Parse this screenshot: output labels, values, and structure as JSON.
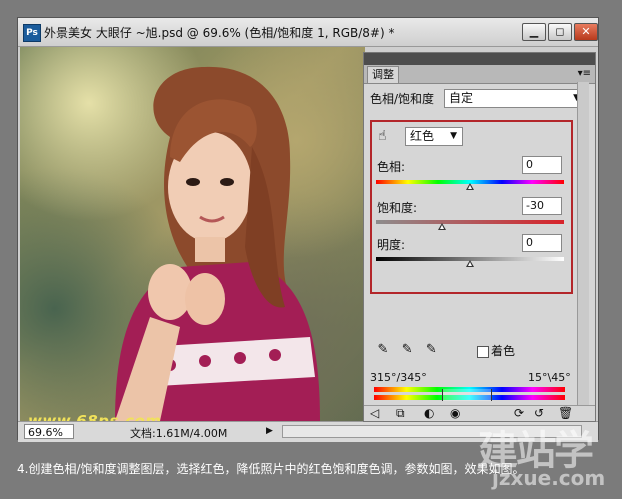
{
  "window": {
    "title": "外景美女 大眼仔 ~旭.psd @ 69.6% (色相/饱和度 1, RGB/8#) *",
    "app_icon": "Ps",
    "minimize_glyph": "▁",
    "restore_glyph": "◻",
    "close_glyph": "✕"
  },
  "canvas": {
    "watermark": "www.68ps.com"
  },
  "status": {
    "zoom": "69.6%",
    "doc_info": "文档:1.61M/4.00M",
    "arrow": "▶"
  },
  "panel": {
    "tab_label": "调整",
    "menu_glyph": "▾≡",
    "preset_label": "色相/饱和度",
    "preset_value": "自定",
    "channel_value": "红色",
    "hue_label": "色相:",
    "hue_value": "0",
    "sat_label": "饱和度:",
    "sat_value": "-30",
    "light_label": "明度:",
    "light_value": "0",
    "colorize_label": "着色",
    "range_left": "315°/345°",
    "range_right": "15°\\45°"
  },
  "adjustments": {
    "hue": 0,
    "saturation": -30,
    "lightness": 0
  },
  "caption": "4.创建色相/饱和度调整图层，选择红色，降低照片中的红色饱和度色调，参数如图，效果如图。",
  "site_watermark": {
    "big": "建站学",
    "small": "jzxue.com"
  }
}
